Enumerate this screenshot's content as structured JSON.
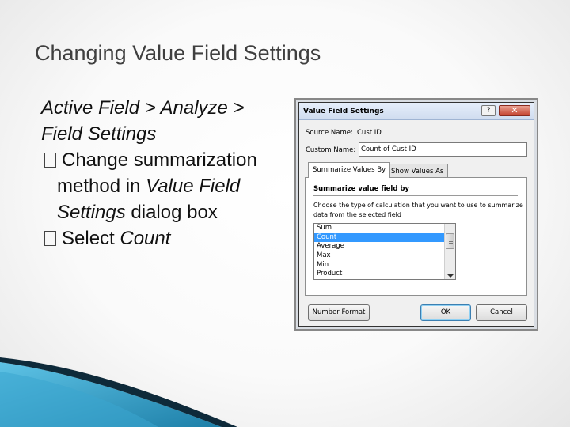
{
  "slide": {
    "title": "Changing Value Field Settings",
    "line1": "Active Field > Analyze >",
    "line2": "Field Settings",
    "bullets": [
      {
        "marker": "",
        "prefix": "Change summarization"
      },
      {
        "marker": "",
        "prefix": "Select "
      }
    ],
    "bullet1_cont1_a": "method in ",
    "bullet1_cont1_b": "Value Field",
    "bullet1_cont2_a": "Settings",
    "bullet1_cont2_b": " dialog box",
    "bullet2_italic": "Count"
  },
  "dialog": {
    "title": "Value Field Settings",
    "help_label": "?",
    "close_label": "✕",
    "source_name_label": "Source Name:",
    "source_name_value": "Cust ID",
    "custom_name_label": "Custom Name:",
    "custom_name_value": "Count of Cust ID",
    "tabs": [
      "Summarize Values By",
      "Show Values As"
    ],
    "section_title": "Summarize value field by",
    "description": "Choose the type of calculation that you want to use to summarize data from the selected field",
    "list_items": [
      "Sum",
      "Count",
      "Average",
      "Max",
      "Min",
      "Product"
    ],
    "selected_item": "Count",
    "number_format_label": "Number Format",
    "ok_label": "OK",
    "cancel_label": "Cancel"
  },
  "colors": {
    "selection": "#3399ff",
    "accent_teal": "#1d7fa8",
    "accent_dark": "#0e2a3a"
  },
  "icons": [
    "help-icon",
    "close-icon",
    "scroll-down-arrow-icon"
  ]
}
